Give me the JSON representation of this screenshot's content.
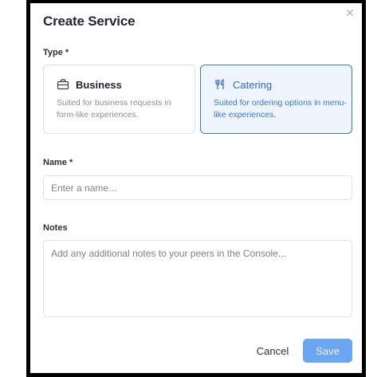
{
  "dialog": {
    "title": "Create Service",
    "close_icon": "close-icon"
  },
  "type_field": {
    "label": "Type *",
    "options": [
      {
        "icon": "briefcase-icon",
        "title": "Business",
        "description": "Suited for business requests in form-like experiences.",
        "selected": false
      },
      {
        "icon": "fork-knife-icon",
        "title": "Catering",
        "description": "Suited for ordering options in menu-like experiences.",
        "selected": true
      }
    ]
  },
  "name_field": {
    "label": "Name *",
    "value": "",
    "placeholder": "Enter a name..."
  },
  "notes_field": {
    "label": "Notes",
    "value": "",
    "placeholder": "Add any additional notes to your peers in the Console..."
  },
  "actions": {
    "cancel_label": "Cancel",
    "save_label": "Save"
  },
  "colors": {
    "accent": "#3a78d4",
    "save_disabled": "#6aa6f2",
    "selected_card_bg": "#eef5fe"
  }
}
